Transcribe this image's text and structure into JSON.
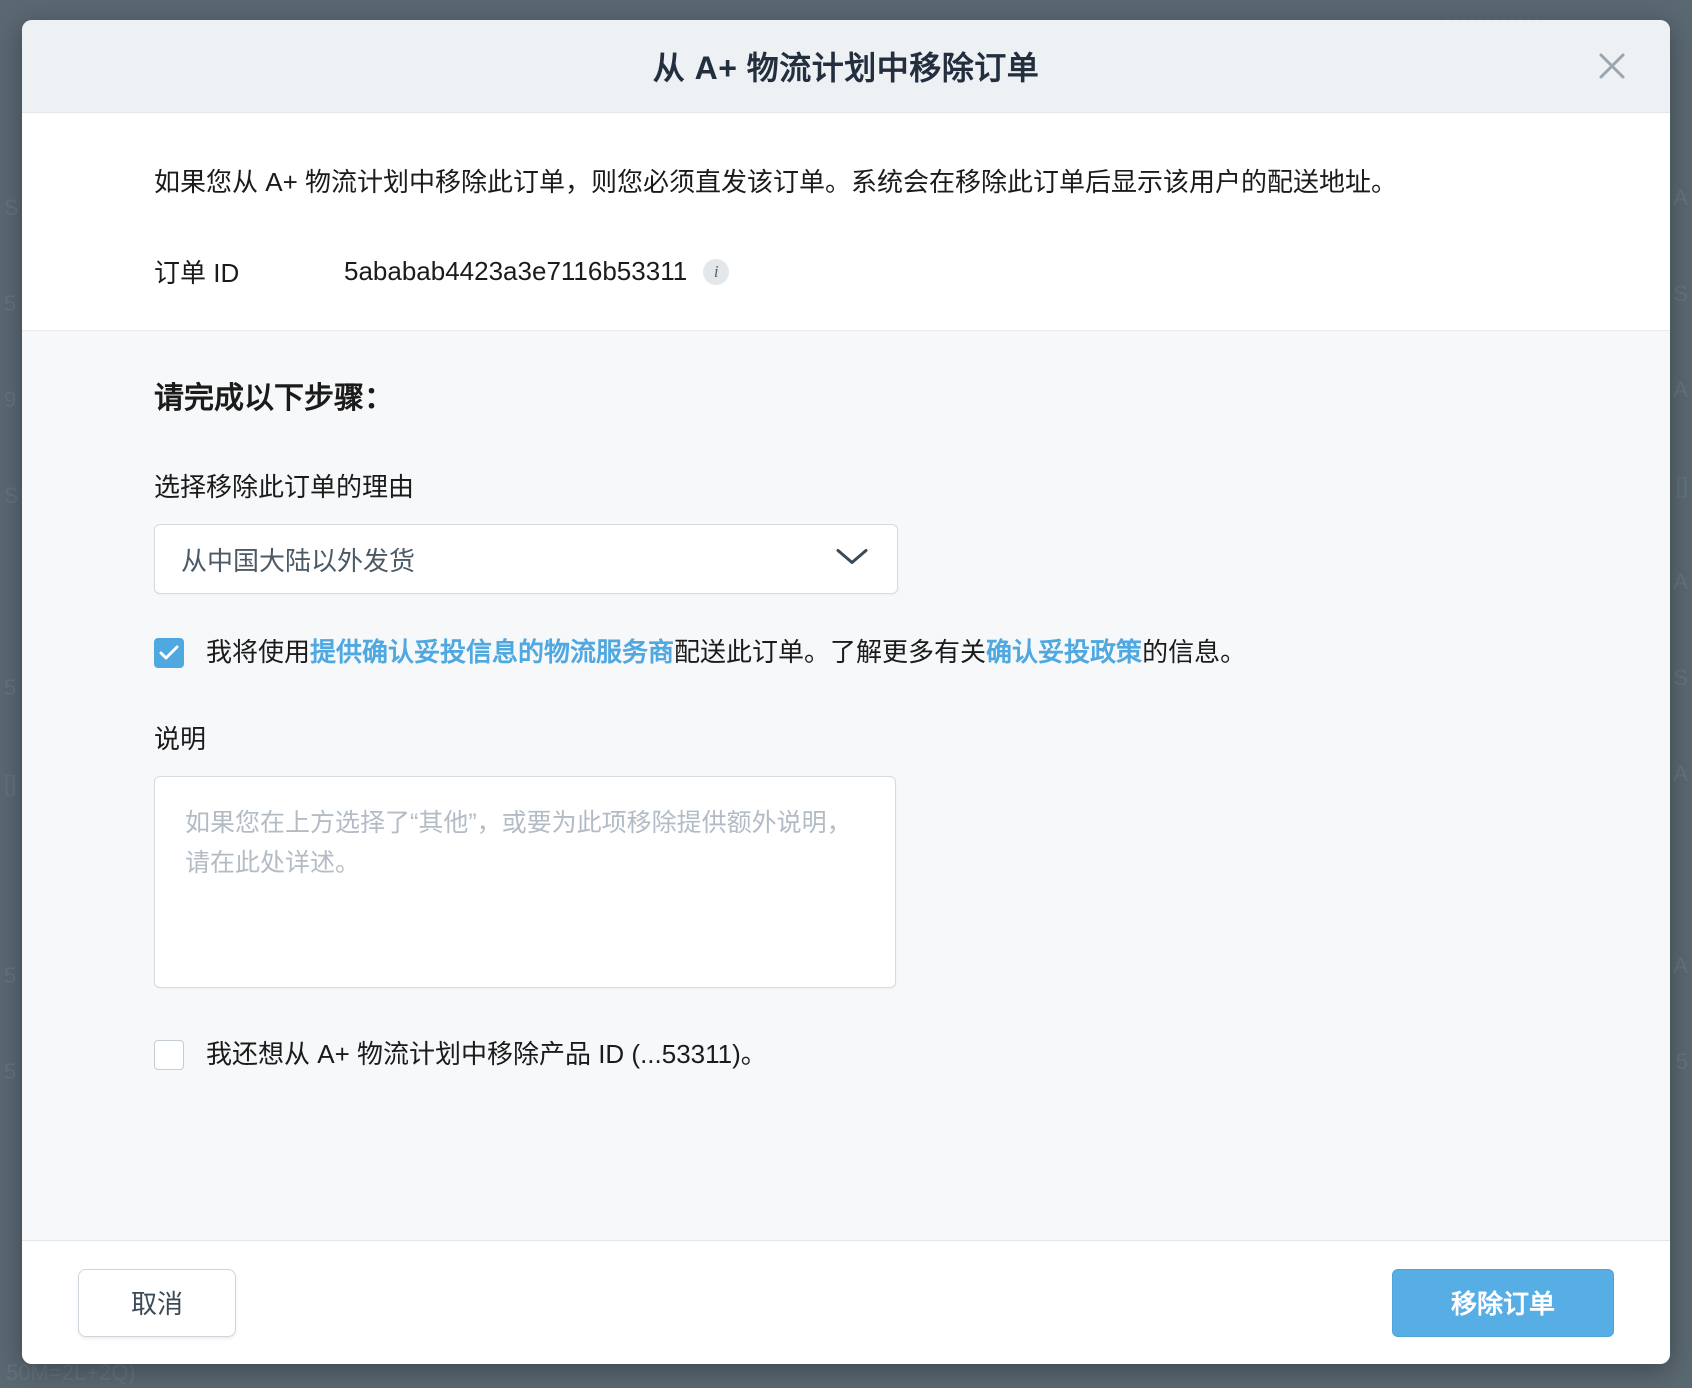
{
  "background": {
    "top_fragment": "............",
    "left_fragments": [
      "S",
      "5",
      "9",
      "S",
      "",
      "5",
      "[]",
      "",
      "5",
      "5"
    ],
    "right_fragments": [
      "A",
      "S",
      "A",
      "[]",
      "A",
      "S",
      "A",
      "",
      "A",
      "5"
    ],
    "bottom_fragment": "50M=2L+2Q)"
  },
  "header": {
    "title": "从 A+ 物流计划中移除订单",
    "close_icon": "close-icon"
  },
  "intro": {
    "paragraph": "如果您从 A+ 物流计划中移除此订单，则您必须直发该订单。系统会在移除此订单后显示该用户的配送地址。",
    "order_id_label": "订单 ID",
    "order_id_value": "5ababab4423a3e7116b53311",
    "info_icon_glyph": "i"
  },
  "steps": {
    "heading": "请完成以下步骤：",
    "reason_label": "选择移除此订单的理由",
    "reason_selected": "从中国大陆以外发货",
    "reason_options": [
      "从中国大陆以外发货"
    ],
    "confirmation": {
      "checked": true,
      "text_part1": "我将使用",
      "link1": "提供确认妥投信息的物流服务商",
      "text_part2": "配送此订单。了解更多有关",
      "link2": "确认妥投政策",
      "text_part3": "的信息。"
    },
    "description_label": "说明",
    "description_placeholder": "如果您在上方选择了“其他”，或要为此项移除提供额外说明，请在此处详述。",
    "description_value": "",
    "remove_product": {
      "checked": false,
      "label": "我还想从 A+ 物流计划中移除产品 ID (...53311)。"
    }
  },
  "footer": {
    "cancel_label": "取消",
    "submit_label": "移除订单"
  },
  "colors": {
    "accent": "#57aee4",
    "link": "#4fa8e0",
    "header_bg": "#eef1f4",
    "body_bg": "#f7f8fa",
    "title_text": "#232f3e"
  }
}
